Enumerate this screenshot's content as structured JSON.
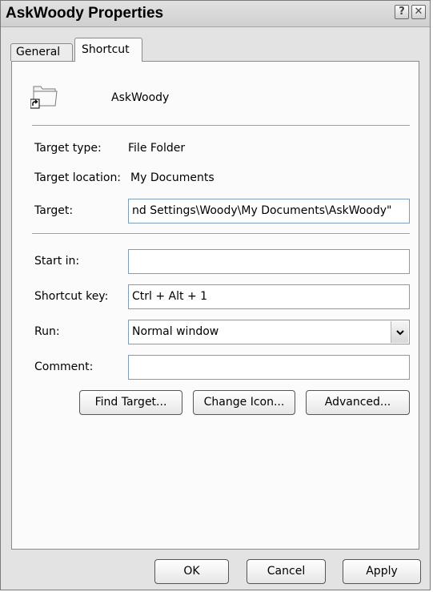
{
  "window": {
    "title": "AskWoody Properties",
    "help_button": "?",
    "close_button": "✕"
  },
  "tabs": [
    {
      "label": "General",
      "active": false
    },
    {
      "label": "Shortcut",
      "active": true
    }
  ],
  "shortcut": {
    "name": "AskWoody",
    "icon": "folder-icon",
    "overlay_icon": "shortcut-arrow-icon"
  },
  "info": {
    "target_type_label": "Target type:",
    "target_type_value": "File Folder",
    "target_location_label": "Target location:",
    "target_location_value": "My Documents"
  },
  "fields": {
    "target_label": "Target:",
    "target_value": "nd Settings\\Woody\\My Documents\\AskWoody\"",
    "start_in_label": "Start in:",
    "start_in_value": "",
    "shortcut_key_label": "Shortcut key:",
    "shortcut_key_value": "Ctrl + Alt + 1",
    "run_label": "Run:",
    "run_value": "Normal window",
    "comment_label": "Comment:",
    "comment_value": ""
  },
  "actions": {
    "find_target": "Find Target...",
    "change_icon": "Change Icon...",
    "advanced": "Advanced..."
  },
  "footer": {
    "ok": "OK",
    "cancel": "Cancel",
    "apply": "Apply"
  }
}
